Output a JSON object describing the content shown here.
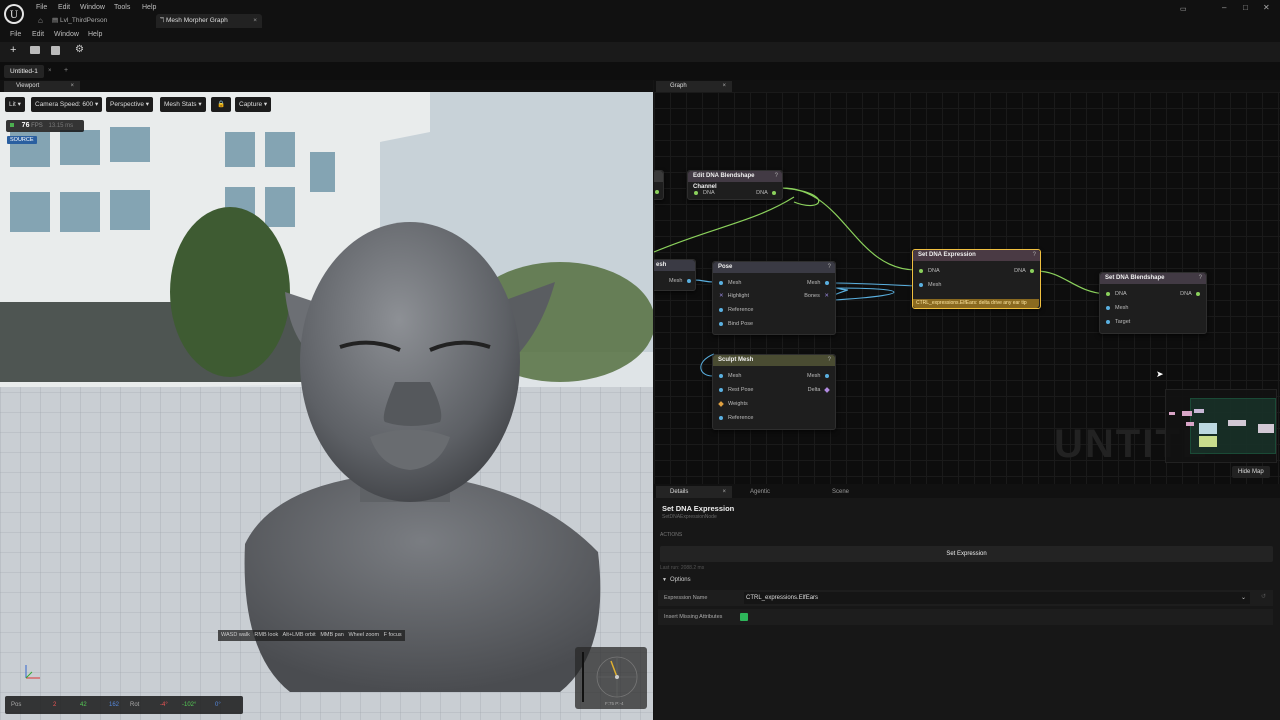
{
  "titlebar": {
    "menu": [
      "File",
      "Edit",
      "Window",
      "Tools",
      "Help"
    ],
    "tabs": [
      {
        "label": "Lvl_ThirdPerson"
      },
      {
        "label": "Mesh Morpher Graph"
      }
    ],
    "close_glyph": "×"
  },
  "submenu": [
    "File",
    "Edit",
    "Window",
    "Help"
  ],
  "doc_tab": {
    "label": "Untitled-1",
    "close": "×",
    "add": "+"
  },
  "viewport": {
    "tab_label": "Viewport",
    "tab_close": "×",
    "buttons": {
      "lit": "Lit",
      "camera_speed": "Camera Speed: 600",
      "perspective": "Perspective",
      "mesh_stats": "Mesh Stats",
      "capture": "Capture"
    },
    "fps_value": "76",
    "fps_unit": "FPS",
    "frame_time": "13.15 ms",
    "source_badge": "SOURCE",
    "hints": [
      "WASD walk",
      "RMB look",
      "Alt+LMB orbit",
      "MMB pan",
      "Wheel zoom",
      "F focus"
    ],
    "pos_label": "Pos",
    "pos_values": [
      "2",
      "42",
      "162"
    ],
    "rot_label": "Rot",
    "rot_values": [
      "-4°",
      "-102°",
      "0°"
    ],
    "compass_label": "F:75 P:-4"
  },
  "graph": {
    "tab_label": "Graph",
    "tab_close": "×",
    "watermark": "UNTITL",
    "hide_map": "Hide Map",
    "nodes": {
      "edit_dna": {
        "title": "Edit DNA Blendshape Channel",
        "in": "DNA",
        "out": "DNA"
      },
      "mesh_partial": {
        "title": "esh",
        "out": "Mesh"
      },
      "pose": {
        "title": "Pose",
        "pins_in": [
          "Mesh",
          "Highlight",
          "Reference",
          "Bind Pose"
        ],
        "pins_out": [
          "Mesh",
          "Bones"
        ]
      },
      "sculpt": {
        "title": "Sculpt Mesh",
        "pins_in": [
          "Mesh",
          "Rest Pose",
          "Weights",
          "Reference"
        ],
        "pins_out": [
          "Mesh",
          "Delta"
        ]
      },
      "set_expr": {
        "title": "Set DNA Expression",
        "in": "DNA",
        "in2": "Mesh",
        "out": "DNA",
        "footer": "CTRL_expressions.ElfEars: delta drive any ear tip"
      },
      "set_blend": {
        "title": "Set DNA Blendshape",
        "pins_in": [
          "DNA",
          "Mesh",
          "Target"
        ],
        "out": "DNA"
      }
    }
  },
  "details": {
    "tabs": [
      "Details",
      "Agentic",
      "Scene"
    ],
    "tab_close": "×",
    "title": "Set DNA Expression",
    "subtitle": "SetDNAExpressionNode",
    "actions_label": "ACTIONS",
    "action_button": "Set Expression",
    "last_run": "Last run: 2088.2 ms",
    "options_label": "Options",
    "expression_name_label": "Expression Name",
    "expression_name_value": "CTRL_expressions.ElfEars",
    "insert_missing_label": "Insert Missing Attributes",
    "insert_missing_checked": true
  },
  "colors": {
    "accent_green": "#8bd15c",
    "node_selected": "#f0c040",
    "pose_head": "#3a3a44",
    "sculpt_head": "#4a4c32",
    "set_head": "#4a3a44"
  }
}
